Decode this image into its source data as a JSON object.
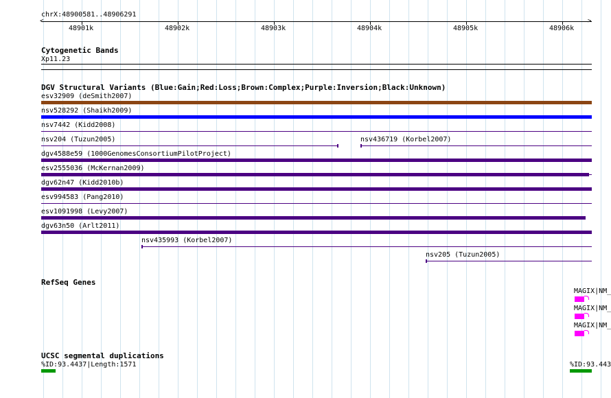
{
  "ruler": {
    "location": "chrX:48900581..48906291",
    "ticks": [
      "48901k",
      "48902k",
      "48903k",
      "48904k",
      "48905k",
      "48906k"
    ]
  },
  "cyto": {
    "title": "Cytogenetic Bands",
    "band": "Xp11.23"
  },
  "dgv": {
    "title": "DGV Structural Variants (Blue:Gain;Red:Loss;Brown:Complex;Purple:Inversion;Black:Unknown)",
    "features": [
      {
        "label": "esv32909 (deSmith2007)",
        "color": "#8b4513"
      },
      {
        "label": "nsv528292 (Shaikh2009)",
        "color": "#0000ff"
      },
      {
        "label": "nsv7442 (Kidd2008)",
        "color": "#4b0082"
      },
      {
        "label": "nsv204 (Tuzun2005)",
        "color": "#4b0082"
      },
      {
        "label": "nsv436719 (Korbel2007)",
        "color": "#4b0082"
      },
      {
        "label": "dgv4588e59 (1000GenomesConsortiumPilotProject)",
        "color": "#4b0082"
      },
      {
        "label": "esv2555036 (McKernan2009)",
        "color": "#4b0082"
      },
      {
        "label": "dgv62n47 (Kidd2010b)",
        "color": "#4b0082"
      },
      {
        "label": "esv994583 (Pang2010)",
        "color": "#4b0082"
      },
      {
        "label": "esv1091998 (Levy2007)",
        "color": "#4b0082"
      },
      {
        "label": "dgv63n50 (Arlt2011)",
        "color": "#4b0082"
      },
      {
        "label": "nsv435993 (Korbel2007)",
        "color": "#4b0082"
      },
      {
        "label": "nsv205 (Tuzun2005)",
        "color": "#4b0082"
      }
    ]
  },
  "refseq": {
    "title": "RefSeq Genes",
    "genes": [
      "MAGIX|NM_",
      "MAGIX|NM_",
      "MAGIX|NM_"
    ],
    "color": "#ff00ff"
  },
  "segdup": {
    "title": "UCSC segmental duplications",
    "labels": [
      "%ID:93.4437|Length:1571",
      "%ID:93.443"
    ],
    "color": "#009900"
  }
}
